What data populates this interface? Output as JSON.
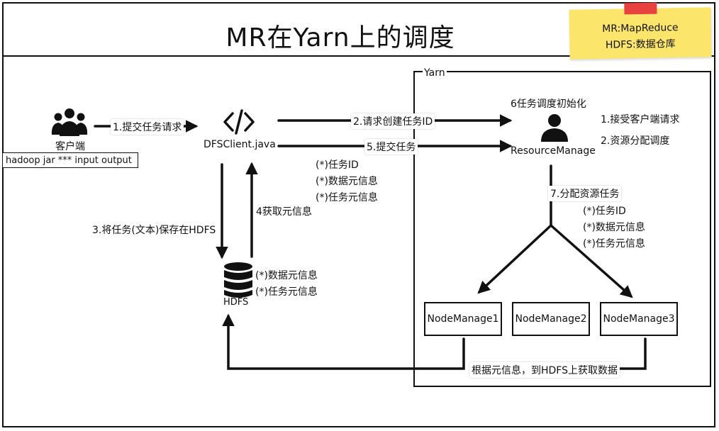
{
  "title": "MR在Yarn上的调度",
  "sticky_note": {
    "line1": "MR:MapReduce",
    "line2": "HDFS:数据仓库"
  },
  "client": {
    "label": "客户端",
    "command": "hadoop jar *** input output"
  },
  "dfsclient": {
    "icon_text": "</>",
    "label": "DFSClient.java"
  },
  "hdfs": {
    "label": "HDFS",
    "metadata": [
      "(*)数据元信息",
      "(*)任务元信息"
    ]
  },
  "yarn": {
    "label": "Yarn",
    "rm_label": "ResourceManage",
    "rm_init": "6任务调度初始化",
    "rm_duties": [
      "1.接受客户端请求",
      "2.资源分配调度"
    ],
    "nodes": [
      "NodeManage1",
      "NodeManage2",
      "NodeManage3"
    ]
  },
  "steps": {
    "s1": "1.提交任务请求",
    "s2": "2.请求创建任务ID",
    "s3": "3.将任务(文本)保存在HDFS",
    "s4": "4获取元信息",
    "s5": "5.提交任务",
    "s7": "7.分配资源任务",
    "s8": "根据元信息，到HDFS上获取数据"
  },
  "task_info_submit": [
    "(*)任务ID",
    "(*)数据元信息",
    "(*)任务元信息"
  ],
  "task_info_assign": [
    "(*)任务ID",
    "(*)数据元信息",
    "(*)任务元信息"
  ],
  "icons": {
    "client": "users-icon",
    "dfsclient": "code-icon",
    "hdfs": "database-icon",
    "rm": "user-icon"
  }
}
